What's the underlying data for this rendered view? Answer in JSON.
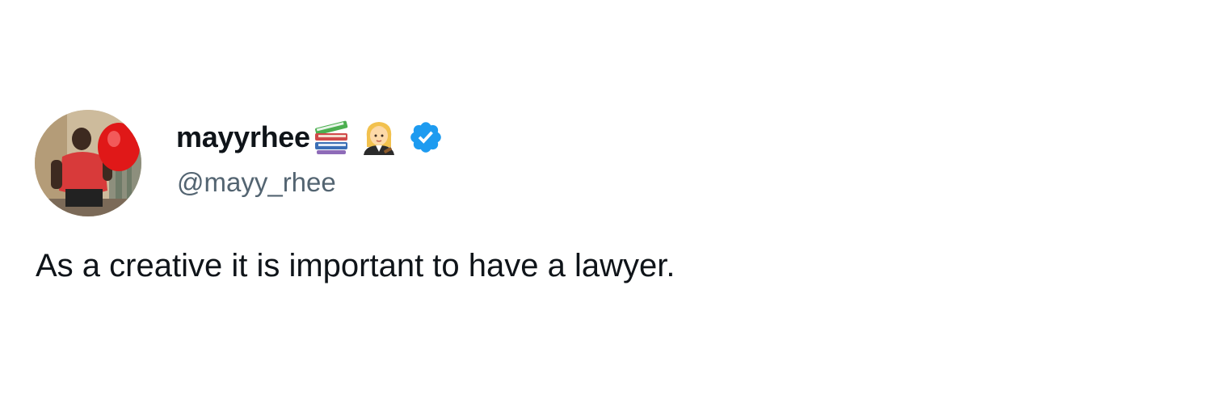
{
  "author": {
    "display_name": "mayyrhee",
    "name_emojis": [
      "books-emoji",
      "woman-judge-emoji"
    ],
    "verified": true,
    "handle": "@mayy_rhee",
    "avatar": "profile-photo"
  },
  "tweet": {
    "text": "As a creative it is important to have a lawyer."
  },
  "colors": {
    "text_primary": "#0f1419",
    "text_secondary": "#536471",
    "verified_blue": "#1d9bf0",
    "background": "#ffffff"
  }
}
